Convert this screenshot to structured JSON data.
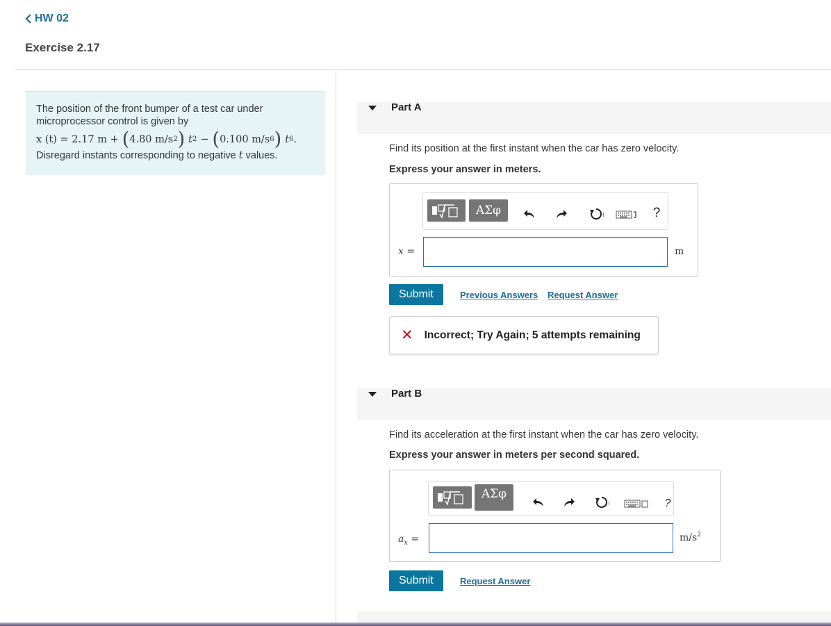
{
  "nav": {
    "back_label": "HW 02"
  },
  "exercise": {
    "title": "Exercise 2.17"
  },
  "problem": {
    "intro": "The position of the front bumper of a test car under microprocessor control is given by",
    "eq": {
      "lhs": "x (t) = 2.17 m +",
      "term1_coeff": "4.80 m/s",
      "term1_exp": "2",
      "term1_var": "t",
      "term1_var_exp": "2",
      "minus": "−",
      "term2_coeff": "0.100 m/s",
      "term2_exp": "6",
      "term2_var": "t",
      "term2_var_exp": "6",
      "end": "."
    },
    "disregard_pre": "Disregard instants corresponding to negative ",
    "disregard_var": "t",
    "disregard_post": " values."
  },
  "part_a": {
    "label": "Part A",
    "question": "Find its position at the first instant when the car has zero velocity.",
    "instruction": "Express your answer in meters.",
    "toolbar": {
      "greek_label": "ΑΣφ",
      "help": "?"
    },
    "var_label": "x",
    "equals": "=",
    "input_value": "",
    "unit": "m",
    "submit_label": "Submit",
    "previous_answers_label": "Previous Answers",
    "request_answer_label": "Request Answer",
    "feedback": {
      "icon": "✕",
      "text": "Incorrect; Try Again; 5 attempts remaining",
      "status_color": "#d0021b"
    }
  },
  "part_b": {
    "label": "Part B",
    "question": "Find its acceleration at the first instant when the car has zero velocity.",
    "instruction": "Express your answer in meters per second squared.",
    "toolbar": {
      "greek_label": "ΑΣφ",
      "help": "?"
    },
    "var_label": "a",
    "var_sub": "x",
    "equals": "=",
    "input_value": "",
    "unit": "m/s",
    "unit_exp": "2",
    "submit_label": "Submit",
    "request_answer_label": "Request Answer"
  },
  "colors": {
    "accent": "#0b77a0",
    "link": "#1a6e9a",
    "problem_bg": "#e6f4f5",
    "input_border": "#2a6fb0"
  }
}
